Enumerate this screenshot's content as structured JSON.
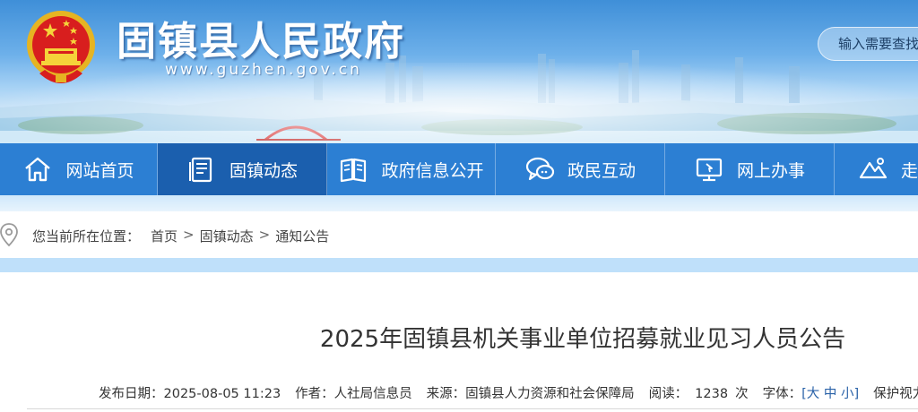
{
  "header": {
    "site_title": "固镇县人民政府",
    "site_url": "www.guzhen.gov.cn",
    "search_placeholder": "输入需要查找"
  },
  "nav": {
    "items": [
      {
        "label": "网站首页",
        "icon": "home-icon"
      },
      {
        "label": "固镇动态",
        "icon": "document-icon",
        "active": true
      },
      {
        "label": "政府信息公开",
        "icon": "book-icon"
      },
      {
        "label": "政民互动",
        "icon": "chat-icon"
      },
      {
        "label": "网上办事",
        "icon": "monitor-icon"
      },
      {
        "label": "走",
        "icon": "mountain-icon"
      }
    ]
  },
  "breadcrumb": {
    "label": "您当前所在位置：",
    "items": [
      "首页",
      "固镇动态",
      "通知公告"
    ],
    "separator": ">"
  },
  "article": {
    "title": "2025年固镇县机关事业单位招募就业见习人员公告",
    "meta": {
      "date_label": "发布日期：",
      "date": "2025-08-05 11:23",
      "author_label": "作者：",
      "author": "人社局信息员",
      "source_label": "来源：",
      "source": "固镇县人力资源和社会保障局",
      "views_label": "阅读：",
      "views": "1238",
      "views_unit": "次",
      "font_label": "字体：",
      "font_open": "[",
      "font_large": "大",
      "font_medium": "中",
      "font_small": "小",
      "font_close": "]",
      "eye_protect": "保护视力色"
    }
  },
  "colors": {
    "nav_bg": "#2c7fd3",
    "nav_active": "#1b5fae",
    "breadcrumb_band": "#bfe0fa"
  }
}
